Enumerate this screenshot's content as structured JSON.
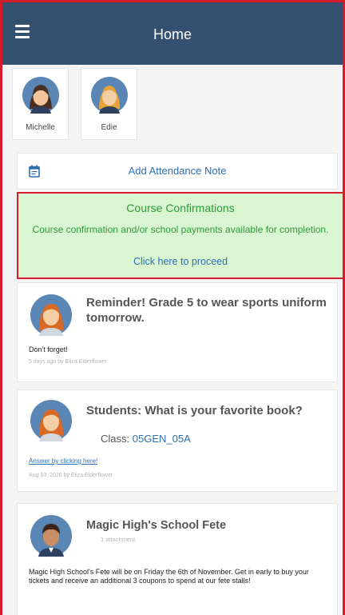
{
  "appbar": {
    "title": "Home"
  },
  "students": [
    {
      "name": "Michelle"
    },
    {
      "name": "Edie"
    }
  ],
  "attendance": {
    "label": "Add Attendance Note"
  },
  "course_confirmations": {
    "title": "Course Confirmations",
    "description": "Course confirmation and/or school payments available for completion.",
    "link": "Click here to proceed"
  },
  "posts": [
    {
      "title": "Reminder! Grade 5 to wear sports uniform tomorrow.",
      "body": "Don't forget!",
      "meta": "5 days ago by Eliza Elderflower"
    },
    {
      "title": "Students: What is your favorite book?",
      "class_label": "Class:",
      "class_value": "05GEN_05A",
      "answer_link": "Answer by clicking here!",
      "meta": "Aug 10, 2020 by Eliza Elderflower"
    },
    {
      "title": "Magic High's School Fete",
      "attachments": "1 attachment",
      "body": "Magic High School's Fete will be on Friday the 6th of November. Get in early to buy your tickets and receive an additional 3 coupons to spend at our fete stalls!"
    }
  ],
  "colors": {
    "appbar": "#34516f",
    "accent_blue": "#2f6fb1",
    "confirm_green_bg": "#d9f5d2",
    "confirm_green_text": "#2e9a3a",
    "highlight_red": "#d61c2a"
  },
  "icons": {
    "menu": "hamburger-menu-icon",
    "calendar": "calendar-note-icon"
  }
}
